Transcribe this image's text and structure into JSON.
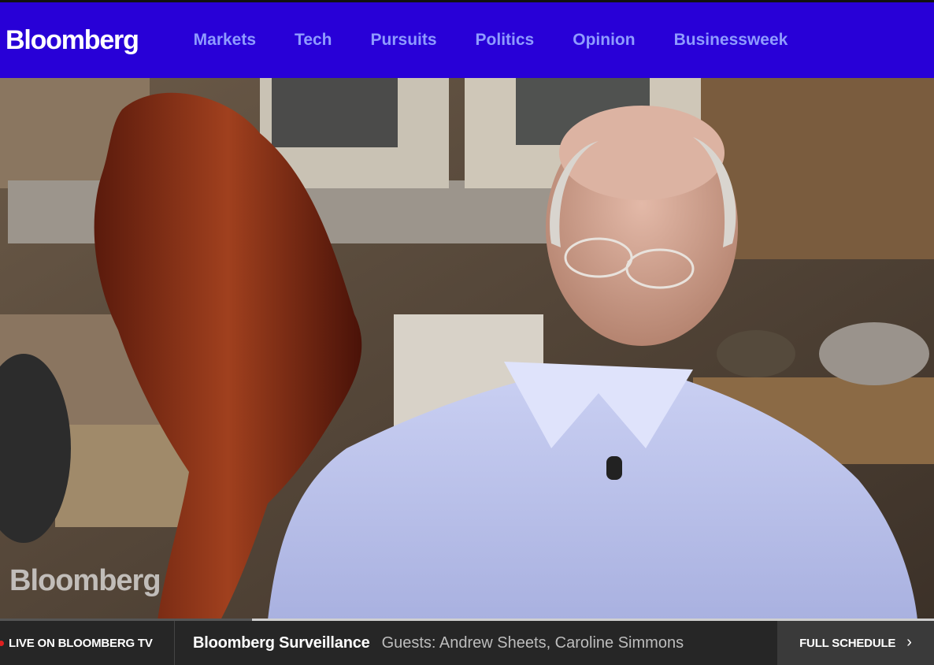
{
  "header": {
    "logo": "Bloomberg",
    "nav": [
      "Markets",
      "Tech",
      "Pursuits",
      "Politics",
      "Opinion",
      "Businessweek"
    ]
  },
  "video": {
    "watermark": "Bloomberg",
    "progress_percent": 27
  },
  "live_bar": {
    "live_label": "LIVE ON BLOOMBERG TV",
    "show_title": "Bloomberg Surveillance",
    "show_guests": "Guests: Andrew Sheets, Caroline Simmons",
    "schedule_label": "FULL SCHEDULE"
  },
  "colors": {
    "header_bg": "#2800d7",
    "nav_link": "#8f9bff",
    "live_dot": "#e02020",
    "live_bar_bg": "#262626"
  },
  "icons": {
    "live_indicator": "red-dot-icon",
    "schedule_arrow": "chevron-right-icon"
  }
}
